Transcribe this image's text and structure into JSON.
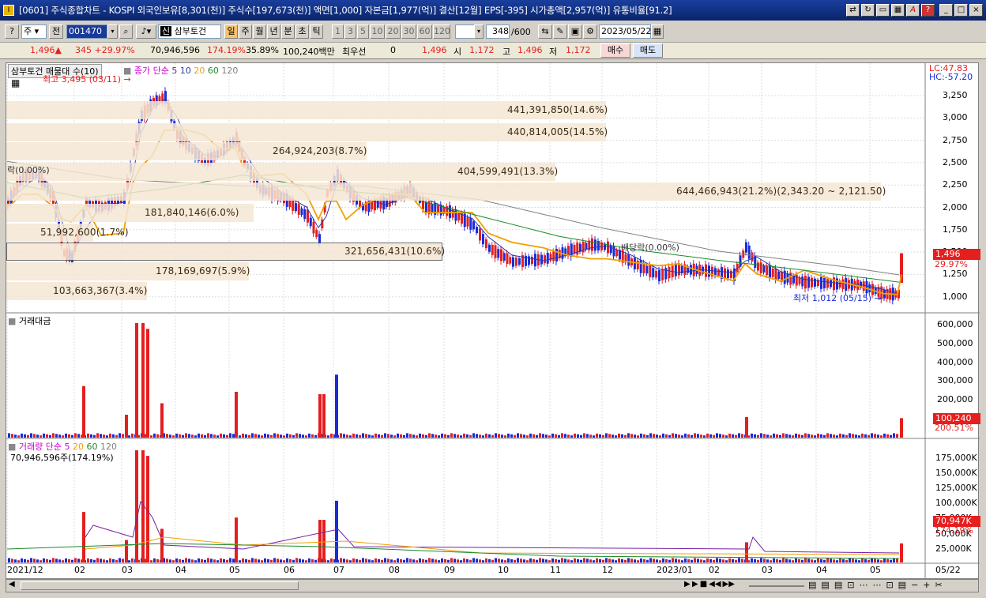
{
  "window": {
    "title": "[0601] 주식종합차트 - KOSPI 외국인보유[8,301(천)] 주식수[197,673(천)] 액면[1,000] 자본금[1,977(억)] 결산[12월] EPS[-395] 시가총액[2,957(억)] 유통비율[91.2]",
    "icon": "I"
  },
  "toolbar": {
    "market": "주",
    "market_all": "전",
    "code": "001470",
    "name": "삼부토건",
    "name_badge": "신",
    "periods": [
      "일",
      "주",
      "월",
      "년",
      "분",
      "초",
      "틱"
    ],
    "active_period": "일",
    "minutes": [
      "1",
      "3",
      "5",
      "10",
      "20",
      "30",
      "60",
      "120"
    ],
    "count": "348",
    "count_max": "/600",
    "date": "2023/05/22"
  },
  "quote": {
    "price": "1,496",
    "arrow": "▲",
    "change": "345",
    "change_rate": "+29.97%",
    "volume": "70,946,596",
    "volume_ratio": "174.19%",
    "turnover": "35.89%",
    "amount": "100,240백만",
    "priority": "최우선",
    "priority_val": "0",
    "bid": "1,496",
    "open_label": "시",
    "open": "1,172",
    "high_label": "고",
    "high": "1,496",
    "low_label": "저",
    "low": "1,172",
    "buy": "매수",
    "sell": "매도"
  },
  "price_panel": {
    "title": "삼부토건 매물대 수(10)",
    "ma_label": "종가 단순",
    "ma_periods": [
      "5",
      "10",
      "20",
      "60",
      "120"
    ],
    "high_marker": "최고 3,495 (03/11)",
    "low_marker": "최저 1,012 (05/15)",
    "dividend": "배당락(0.00%)",
    "left_cut": "락(0.00%)",
    "lc": "LC:47.83",
    "hc": "HC:-57.20",
    "price_tag": "1,496",
    "price_tag_pct": "29.97%",
    "y_ticks": [
      "3,250",
      "3,000",
      "2,750",
      "2,500",
      "2,250",
      "2,000",
      "1,750",
      "1,500",
      "1,250",
      "1,000"
    ],
    "volume_profile": [
      {
        "label": "441,391,850(14.6%)"
      },
      {
        "label": "440,814,005(14.5%)"
      },
      {
        "label": "264,924,203(8.7%)"
      },
      {
        "label": "404,599,491(13.3%)"
      },
      {
        "label": "644,466,943(21.2%)(2,343.20 ~ 2,121.50)"
      },
      {
        "label": "181,840,146(6.0%)"
      },
      {
        "label": "51,992,600(1.7%)"
      },
      {
        "label": "321,656,431(10.6%)"
      },
      {
        "label": "178,169,697(5.9%)"
      },
      {
        "label": "103,663,367(3.4%)"
      }
    ]
  },
  "amount_panel": {
    "title": "거래대금",
    "y_ticks": [
      "600,000",
      "500,000",
      "400,000",
      "300,000",
      "200,000"
    ],
    "tag": "100,240",
    "tag_pct": "200.51%"
  },
  "volume_panel": {
    "title": "거래량 단순",
    "ma_periods": [
      "5",
      "20",
      "60",
      "120"
    ],
    "value": "70,946,596주(174.19%)",
    "y_ticks": [
      "175,000K",
      "150,000K",
      "125,000K",
      "100,000K",
      "75,000K",
      "50,000K",
      "25,000K"
    ],
    "tag": "70,947K",
    "tag_pct": "174.19%"
  },
  "x_axis": [
    "2021/12",
    "02",
    "03",
    "04",
    "05",
    "06",
    "07",
    "08",
    "09",
    "10",
    "11",
    "12",
    "2023/01",
    "02",
    "03",
    "04",
    "05",
    "05/22"
  ],
  "colors": {
    "up": "#e51e1e",
    "down": "#1a2bd8",
    "ma5": "#7a1fa2",
    "ma10": "#2a3aa8",
    "ma20": "#f0a000",
    "ma60": "#1a8a2a",
    "ma120": "#808080",
    "profile": "#f5e6d3"
  },
  "chart_data": {
    "type": "candlestick",
    "x_range": [
      "2021/12",
      "2023/05/22"
    ],
    "y_range": [
      1000,
      3400
    ],
    "key_points": [
      {
        "date": "03/11",
        "high": 3495
      },
      {
        "date": "05/15",
        "low": 1012
      },
      {
        "date": "05/22",
        "close": 1496
      }
    ]
  }
}
